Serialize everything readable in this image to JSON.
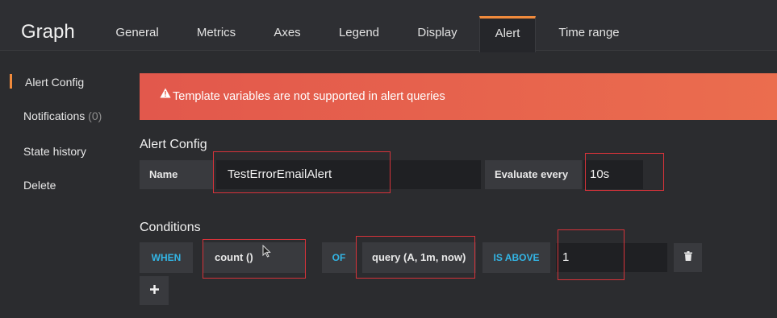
{
  "panel": {
    "title": "Graph"
  },
  "tabs": [
    {
      "label": "General"
    },
    {
      "label": "Metrics"
    },
    {
      "label": "Axes"
    },
    {
      "label": "Legend"
    },
    {
      "label": "Display"
    },
    {
      "label": "Alert",
      "active": true
    },
    {
      "label": "Time range"
    }
  ],
  "sidenav": {
    "items": [
      {
        "label": "Alert Config",
        "active": true
      },
      {
        "label": "Notifications",
        "count": "(0)"
      },
      {
        "label": "State history"
      },
      {
        "label": "Delete"
      }
    ]
  },
  "banner": {
    "icon": "warning-icon",
    "message": "Template variables are not supported in alert queries",
    "color": "#e95f4c"
  },
  "alert_config": {
    "title": "Alert Config",
    "name_label": "Name",
    "name_value": "TestErrorEmailAlert",
    "evaluate_label": "Evaluate every",
    "evaluate_value": "10s"
  },
  "conditions": {
    "title": "Conditions",
    "when_label": "WHEN",
    "reducer": "count ()",
    "of_label": "OF",
    "query": "query (A, 1m, now)",
    "evaluator": "IS ABOVE",
    "threshold": "1",
    "delete_icon": "trash-icon",
    "add_icon": "plus-icon"
  },
  "colors": {
    "accent": "#f08a3c",
    "keyword": "#33b5e5",
    "highlight_outline": "#d6333a"
  }
}
